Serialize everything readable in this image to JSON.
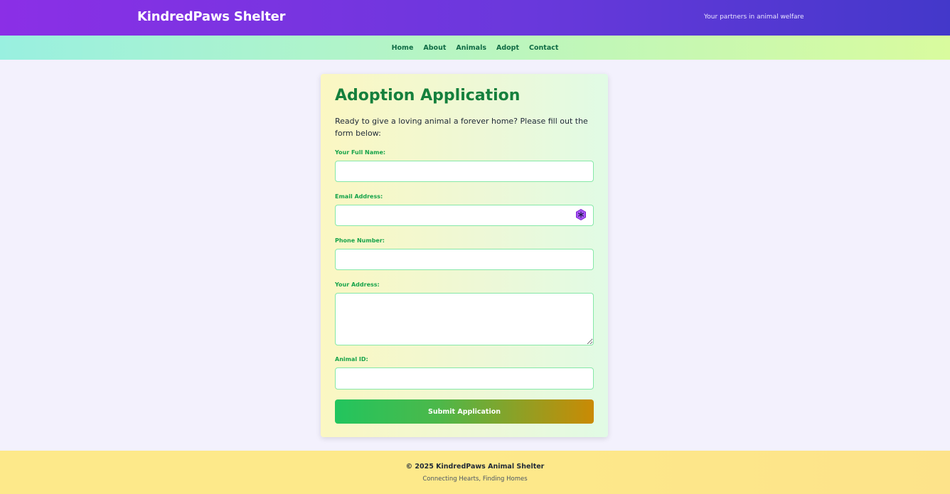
{
  "header": {
    "brand": "KindredPaws Shelter",
    "tagline": "Your partners in animal welfare"
  },
  "nav": {
    "items": [
      {
        "label": "Home"
      },
      {
        "label": "About"
      },
      {
        "label": "Animals"
      },
      {
        "label": "Adopt"
      },
      {
        "label": "Contact"
      }
    ]
  },
  "form": {
    "title": "Adoption Application",
    "intro": "Ready to give a loving animal a forever home? Please fill out the form below:",
    "fields": {
      "full_name": {
        "label": "Your Full Name:",
        "value": ""
      },
      "email": {
        "label": "Email Address:",
        "value": ""
      },
      "phone": {
        "label": "Phone Number:",
        "value": ""
      },
      "address": {
        "label": "Your Address:",
        "value": ""
      },
      "animal_id": {
        "label": "Animal ID:",
        "value": ""
      }
    },
    "submit_label": "Submit Application",
    "email_autofill_icon": "password-manager-icon"
  },
  "footer": {
    "copyright": "© 2025 KindredPaws Animal Shelter",
    "slogan": "Connecting Hearts, Finding Homes"
  },
  "colors": {
    "header_start": "#8b2fe6",
    "header_end": "#4338ca",
    "title_green": "#15803d",
    "label_green": "#16a34a",
    "footer_yellow": "#fde98a"
  }
}
